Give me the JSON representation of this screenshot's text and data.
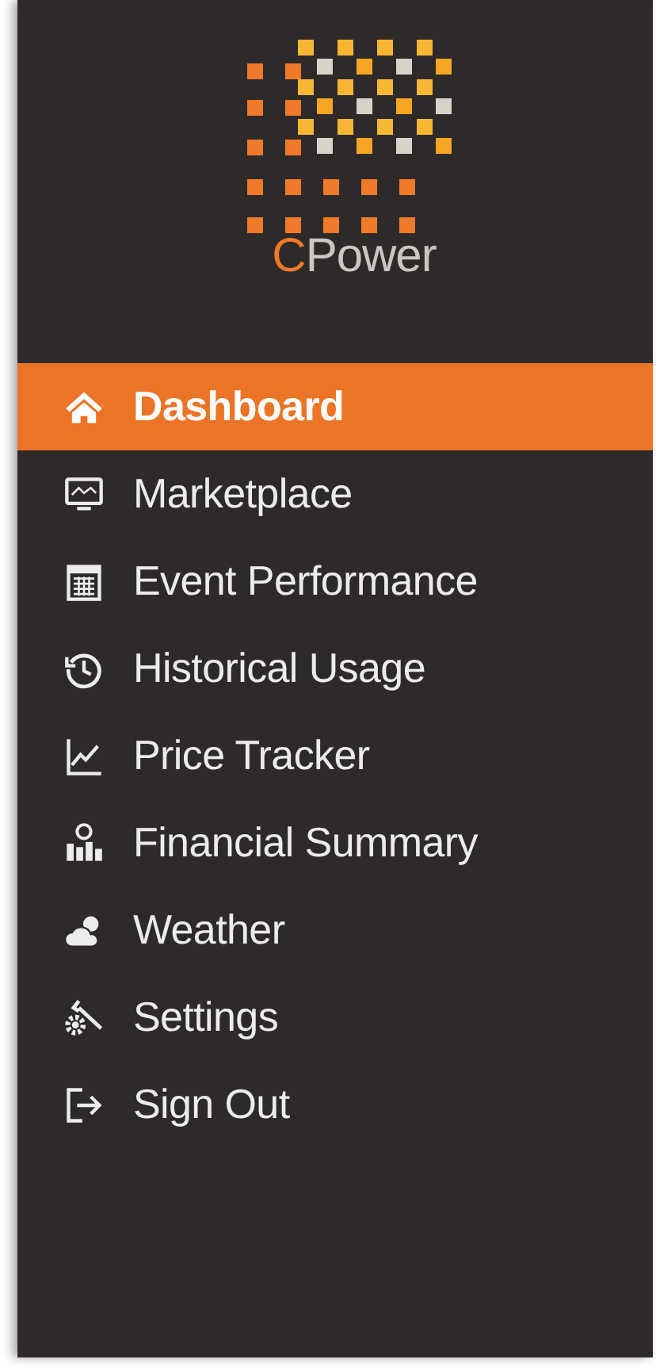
{
  "brand": {
    "accent": "C",
    "rest": "Power"
  },
  "menu": [
    {
      "label": "Dashboard",
      "selected": true
    },
    {
      "label": "Marketplace",
      "selected": false
    },
    {
      "label": "Event Performance",
      "selected": false
    },
    {
      "label": "Historical Usage",
      "selected": false
    },
    {
      "label": "Price Tracker",
      "selected": false
    },
    {
      "label": "Financial Summary",
      "selected": false
    },
    {
      "label": "Weather",
      "selected": false
    },
    {
      "label": "Settings",
      "selected": false
    },
    {
      "label": "Sign Out",
      "selected": false
    }
  ]
}
